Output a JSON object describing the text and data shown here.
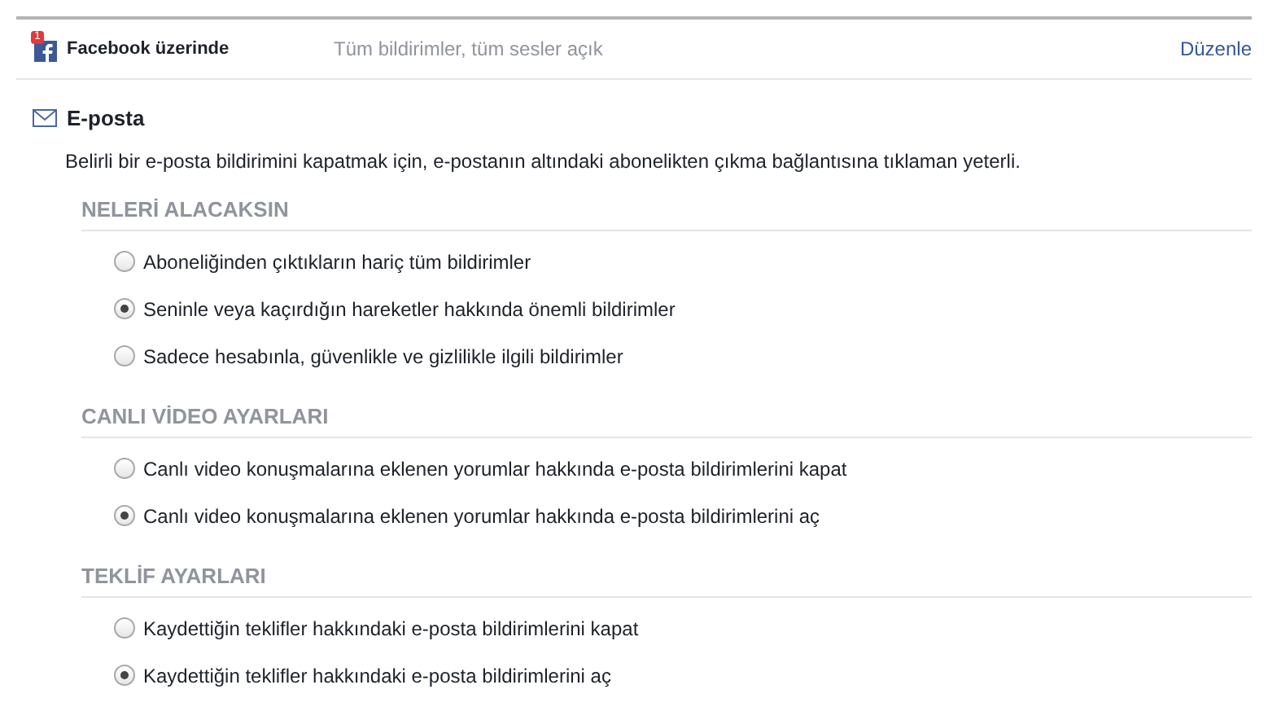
{
  "facebook_row": {
    "badge": "1",
    "title": "Facebook üzerinde",
    "summary": "Tüm bildirimler, tüm sesler açık",
    "edit_link": "Düzenle"
  },
  "email": {
    "title": "E-posta",
    "description": "Belirli bir e-posta bildirimini kapatmak için, e-postanın altındaki abonelikten çıkma bağlantısına tıklaman yeterli.",
    "sections": [
      {
        "heading": "NELERİ ALACAKSIN",
        "options": [
          {
            "label": "Aboneliğinden çıktıkların hariç tüm bildirimler",
            "selected": false
          },
          {
            "label": "Seninle veya kaçırdığın hareketler hakkında önemli bildirimler",
            "selected": true
          },
          {
            "label": "Sadece hesabınla, güvenlikle ve gizlilikle ilgili bildirimler",
            "selected": false
          }
        ]
      },
      {
        "heading": "CANLI VİDEO AYARLARI",
        "options": [
          {
            "label": "Canlı video konuşmalarına eklenen yorumlar hakkında e-posta bildirimlerini kapat",
            "selected": false
          },
          {
            "label": "Canlı video konuşmalarına eklenen yorumlar hakkında e-posta bildirimlerini aç",
            "selected": true
          }
        ]
      },
      {
        "heading": "TEKLİF AYARLARI",
        "options": [
          {
            "label": "Kaydettiğin teklifler hakkındaki e-posta bildirimlerini kapat",
            "selected": false
          },
          {
            "label": "Kaydettiğin teklifler hakkındaki e-posta bildirimlerini aç",
            "selected": true
          }
        ]
      }
    ]
  }
}
